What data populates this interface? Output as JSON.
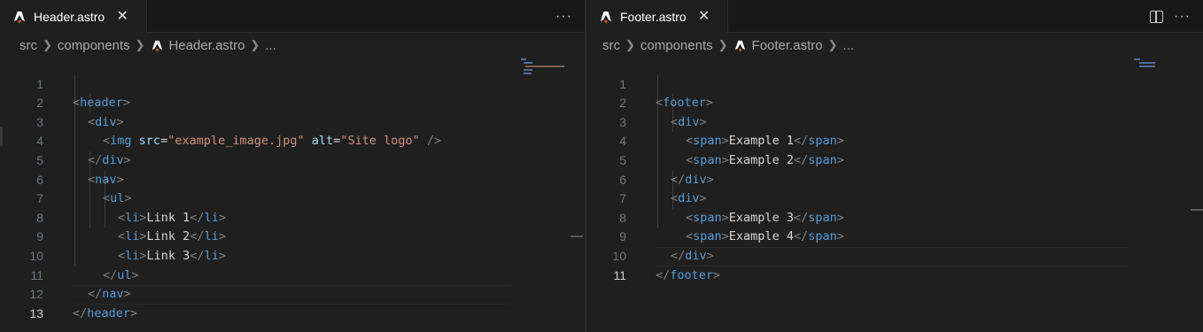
{
  "left_editor": {
    "tab": {
      "label": "Header.astro",
      "icon": "astro-icon",
      "close": "✕"
    },
    "actions": {
      "more": "···"
    },
    "breadcrumb": {
      "folder1": "src",
      "folder2": "components",
      "file": "Header.astro",
      "more": "..."
    },
    "current_line": 13,
    "lines": [
      {
        "n": "1",
        "indent": 0
      },
      {
        "n": "2",
        "indent": 1
      },
      {
        "n": "3",
        "indent": 2
      },
      {
        "n": "4",
        "indent": 1
      },
      {
        "n": "5",
        "indent": 1
      },
      {
        "n": "6",
        "indent": 2
      },
      {
        "n": "7",
        "indent": 3
      },
      {
        "n": "8",
        "indent": 3
      },
      {
        "n": "9",
        "indent": 3
      },
      {
        "n": "10",
        "indent": 2
      },
      {
        "n": "11",
        "indent": 1
      },
      {
        "n": "12",
        "indent": 0
      },
      {
        "n": "13",
        "indent": 0
      }
    ],
    "code": {
      "header": "header",
      "div": "div",
      "img": "img",
      "src_attr": "src",
      "src_val": "\"example_image.jpg\"",
      "alt_attr": "alt",
      "alt_val": "\"Site logo\"",
      "nav": "nav",
      "ul": "ul",
      "li": "li",
      "link1": "Link 1",
      "link2": "Link 2",
      "link3": "Link 3"
    }
  },
  "right_editor": {
    "tab": {
      "label": "Footer.astro",
      "icon": "astro-icon",
      "close": "✕"
    },
    "actions": {
      "split": "split-editor-icon",
      "more": "···"
    },
    "breadcrumb": {
      "folder1": "src",
      "folder2": "components",
      "file": "Footer.astro",
      "more": "..."
    },
    "current_line": 11,
    "lines": [
      {
        "n": "1"
      },
      {
        "n": "2"
      },
      {
        "n": "3"
      },
      {
        "n": "4"
      },
      {
        "n": "5"
      },
      {
        "n": "6"
      },
      {
        "n": "7"
      },
      {
        "n": "8"
      },
      {
        "n": "9"
      },
      {
        "n": "10"
      },
      {
        "n": "11"
      }
    ],
    "code": {
      "footer": "footer",
      "div": "div",
      "span": "span",
      "ex1": "Example 1",
      "ex2": "Example 2",
      "ex3": "Example 3",
      "ex4": "Example 4"
    }
  },
  "colors": {
    "tag": "#569cd6",
    "punct": "#808080",
    "attr": "#9cdcfe",
    "string": "#ce9178",
    "text": "#d4d4d4",
    "background": "#1f1f1f"
  }
}
